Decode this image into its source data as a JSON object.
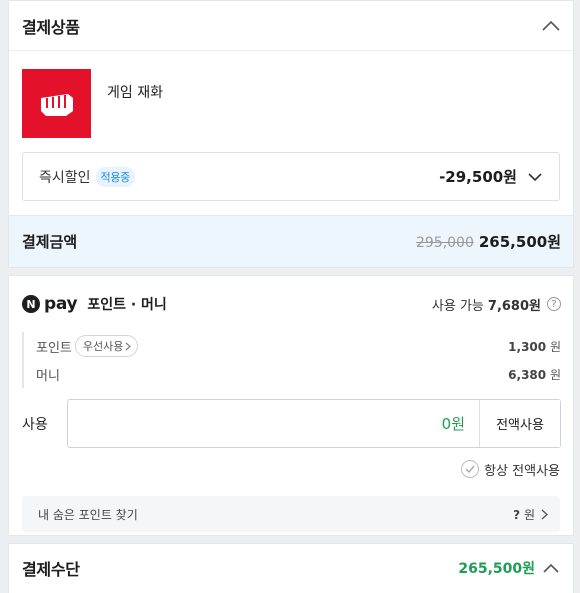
{
  "product_section": {
    "title": "결제상품",
    "product_name": "게임 재화",
    "discount": {
      "label": "즉시할인",
      "badge": "적용중",
      "amount": "-29,500원"
    },
    "total": {
      "label": "결제금액",
      "original_price": "295,000",
      "final_price": "265,500원"
    }
  },
  "point_section": {
    "brand_letter": "N",
    "brand_word": "pay",
    "title": "포인트 · 머니",
    "available_label": "사용 가능",
    "available_amount": "7,680원",
    "info_icon_glyph": "?",
    "items": [
      {
        "label": "포인트",
        "pill": "우선사용",
        "value": "1,300",
        "unit": "원"
      },
      {
        "label": "머니",
        "value": "6,380",
        "unit": "원"
      }
    ],
    "use_label": "사용",
    "use_value": "0원",
    "use_all_button": "전액사용",
    "always_use_label": "항상 전액사용",
    "hidden_points_label": "내 숨은 포인트 찾기",
    "hidden_points_value": "?",
    "hidden_points_unit": "원"
  },
  "method_section": {
    "title": "결제수단",
    "amount": "265,500원"
  },
  "colors": {
    "brand_red": "#e4112b",
    "accent_green": "#1f9d55",
    "badge_blue": "#1a8be8",
    "total_bg": "#edf6fd"
  }
}
